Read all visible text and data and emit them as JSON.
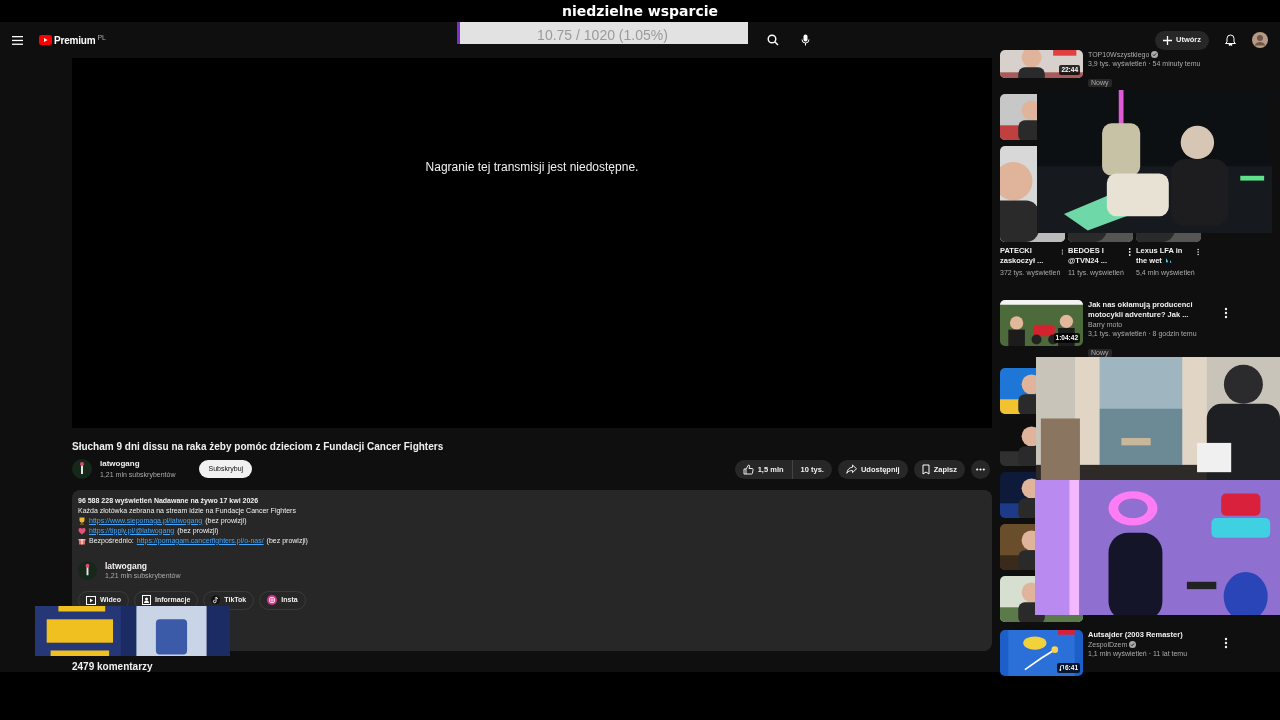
{
  "stream_overlay": {
    "title": "niedzielne wsparcie",
    "goal": {
      "level": 0.0105,
      "reading": "10.75 / 1020 (1.05%)"
    }
  },
  "header": {
    "logo": "Premium",
    "region": "PL",
    "create_button": "Utwórz"
  },
  "player": {
    "message": "Nagranie tej transmisji jest niedostępne."
  },
  "video": {
    "title": "Słucham 9 dni dissu na raka żeby pomóc dzieciom z Fundacji Cancer Fighters",
    "channel": {
      "name": "latwogang",
      "subscribers": "1,21 mln subskrybentów"
    },
    "subscribe": "Subskrybuj",
    "likes": "1,5 mln",
    "dislikes": "10 tys.",
    "share": "Udostępnij",
    "save": "Zapisz"
  },
  "description": {
    "stats": "96 588 228 wyświetleń  Nadawane na żywo 17 kwi 2026",
    "lines": [
      {
        "kind": "text",
        "text": "Każda złotówka zebrana na stream idzie na Fundacje Cancer Fighters"
      },
      {
        "kind": "link",
        "link": "https://www.siepomaga.pl/latwogang",
        "suffix": "(bez prowizji)"
      },
      {
        "kind": "link",
        "link": "https://tipply.pl/@latwogang",
        "suffix": "(bez prowizji)"
      },
      {
        "kind": "link",
        "prefix": "Bezpośrednio:",
        "link": "https://pomagam.cancerfighters.pl/o-nas/",
        "suffix": "(bez prowizji)"
      }
    ],
    "channel": {
      "name": "latwogang",
      "subscribers": "1,21 mln subskrybentów"
    },
    "tabs": [
      "Wideo",
      "Informacje",
      "TikTok",
      "Insta"
    ]
  },
  "comments": {
    "count": "2479 komentarzy"
  },
  "related": [
    {
      "kind": "video",
      "cut_top": true,
      "duration": "22:44",
      "channel": "TOP10Wszystkiego",
      "verified": true,
      "meta": "3,9 tys. wyświetleń · 54 minuty temu",
      "badge": "Nowy"
    },
    {
      "kind": "covered"
    },
    {
      "kind": "shorts",
      "items": [
        {
          "title": "PATECKI zaskoczył ...",
          "views": "372 tys. wyświetleń",
          "splash": false
        },
        {
          "title": "BEDOES I @TVN24 ...",
          "views": "11 tys. wyświetleń",
          "splash": false
        },
        {
          "title": "Lexus LFA in the wet",
          "views": "5,4 mln wyświetleń",
          "splash": true
        }
      ]
    },
    {
      "kind": "video",
      "title": "Jak nas okłamują producenci motocykli adventure? Jak ...",
      "duration": "1:04:42",
      "channel": "Barry moto",
      "verified": false,
      "meta": "3,1 tys. wyświetleń · 8 godzin temu",
      "badge": "Nowy"
    },
    {
      "kind": "covered"
    },
    {
      "kind": "covered"
    },
    {
      "kind": "covered"
    },
    {
      "kind": "covered"
    },
    {
      "kind": "covered"
    },
    {
      "kind": "video",
      "title": "Autsajder (2003 Remaster)",
      "duration": "6:41",
      "music": true,
      "channel": "ZespolDzem",
      "verified": true,
      "meta": "1,1 mln wyświetleń · 11 lat temu"
    }
  ]
}
